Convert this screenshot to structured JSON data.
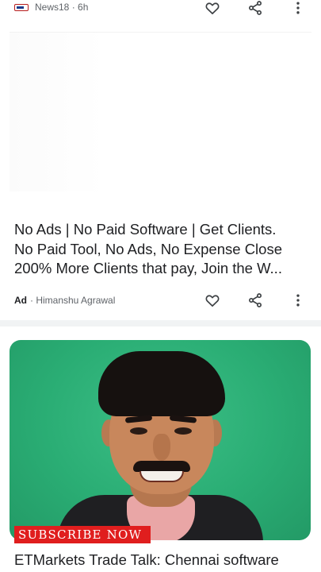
{
  "cards": [
    {
      "source": "News18 · 6h",
      "source_icon": "news18-logo",
      "image_icon": "image-placeholder",
      "actions": [
        "heart-icon",
        "share-icon",
        "more-vert-icon"
      ]
    },
    {
      "headline_lines": [
        "No Ads | No Paid Software | Get Clients.",
        "No Paid Tool, No Ads, No Expense Close",
        "200% More Clients that pay, Join the W..."
      ],
      "ad_label": "Ad",
      "source": "· Himanshu Agrawal",
      "actions": [
        "heart-icon",
        "share-icon",
        "more-vert-icon"
      ]
    },
    {
      "image_description": "portrait-photo",
      "overlay_text": "SUBSCRIBE NOW",
      "headline": "ETMarkets Trade Talk: Chennai software"
    }
  ],
  "colors": {
    "text": "#202124",
    "secondary_text": "#5f6368",
    "icon": "#3c4043",
    "hero_background": "#2aad74",
    "subscribe_banner": "#e01e1e"
  }
}
